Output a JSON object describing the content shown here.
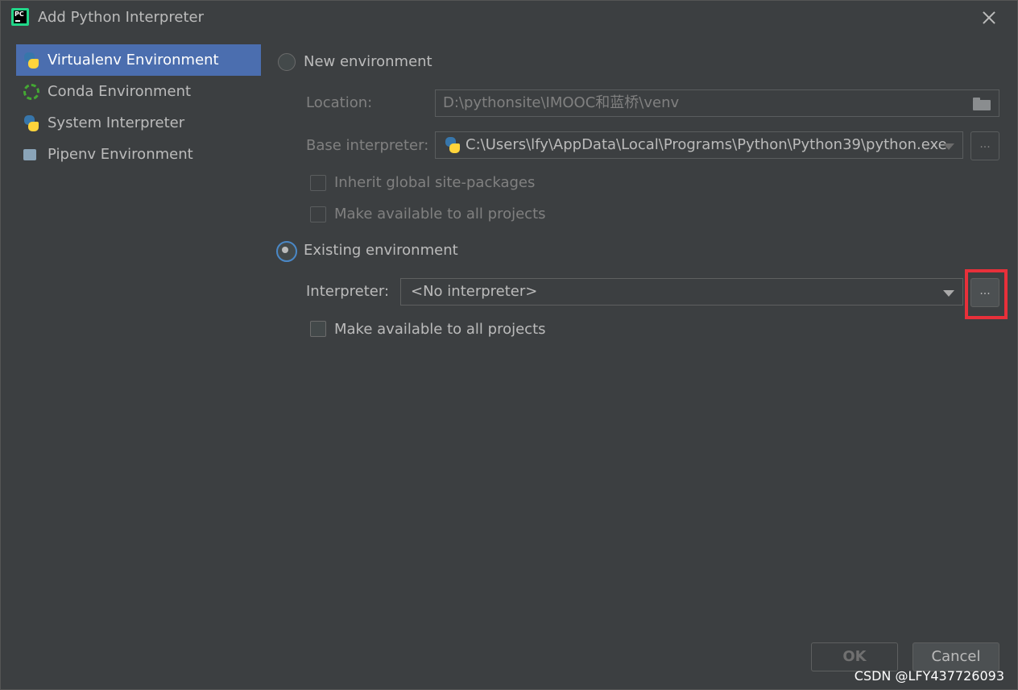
{
  "window": {
    "title": "Add Python Interpreter"
  },
  "sidebar": {
    "items": [
      {
        "label": "Virtualenv Environment",
        "icon": "python-virtualenv-icon",
        "selected": true
      },
      {
        "label": "Conda Environment",
        "icon": "conda-icon",
        "selected": false
      },
      {
        "label": "System Interpreter",
        "icon": "python-icon",
        "selected": false
      },
      {
        "label": "Pipenv Environment",
        "icon": "pipenv-icon",
        "selected": false
      }
    ]
  },
  "new_env": {
    "radio_label": "New environment",
    "location_label": "Location:",
    "location_value": "D:\\pythonsite\\IMOOC和蓝桥\\venv",
    "base_label": "Base interpreter:",
    "base_value": "C:\\Users\\lfy\\AppData\\Local\\Programs\\Python\\Python39\\python.exe",
    "inherit_label": "Inherit global site-packages",
    "make_available_label": "Make available to all projects",
    "browse_label": "..."
  },
  "existing_env": {
    "radio_label": "Existing environment",
    "interpreter_label": "Interpreter:",
    "interpreter_value": "<No interpreter>",
    "browse_label": "...",
    "make_available_label": "Make available to all projects"
  },
  "footer": {
    "ok_label": "OK",
    "cancel_label": "Cancel",
    "watermark": "CSDN @LFY437726093"
  },
  "colors": {
    "background": "#3c3f41",
    "selection": "#4b6eaf",
    "highlight_box": "#e8303a"
  }
}
